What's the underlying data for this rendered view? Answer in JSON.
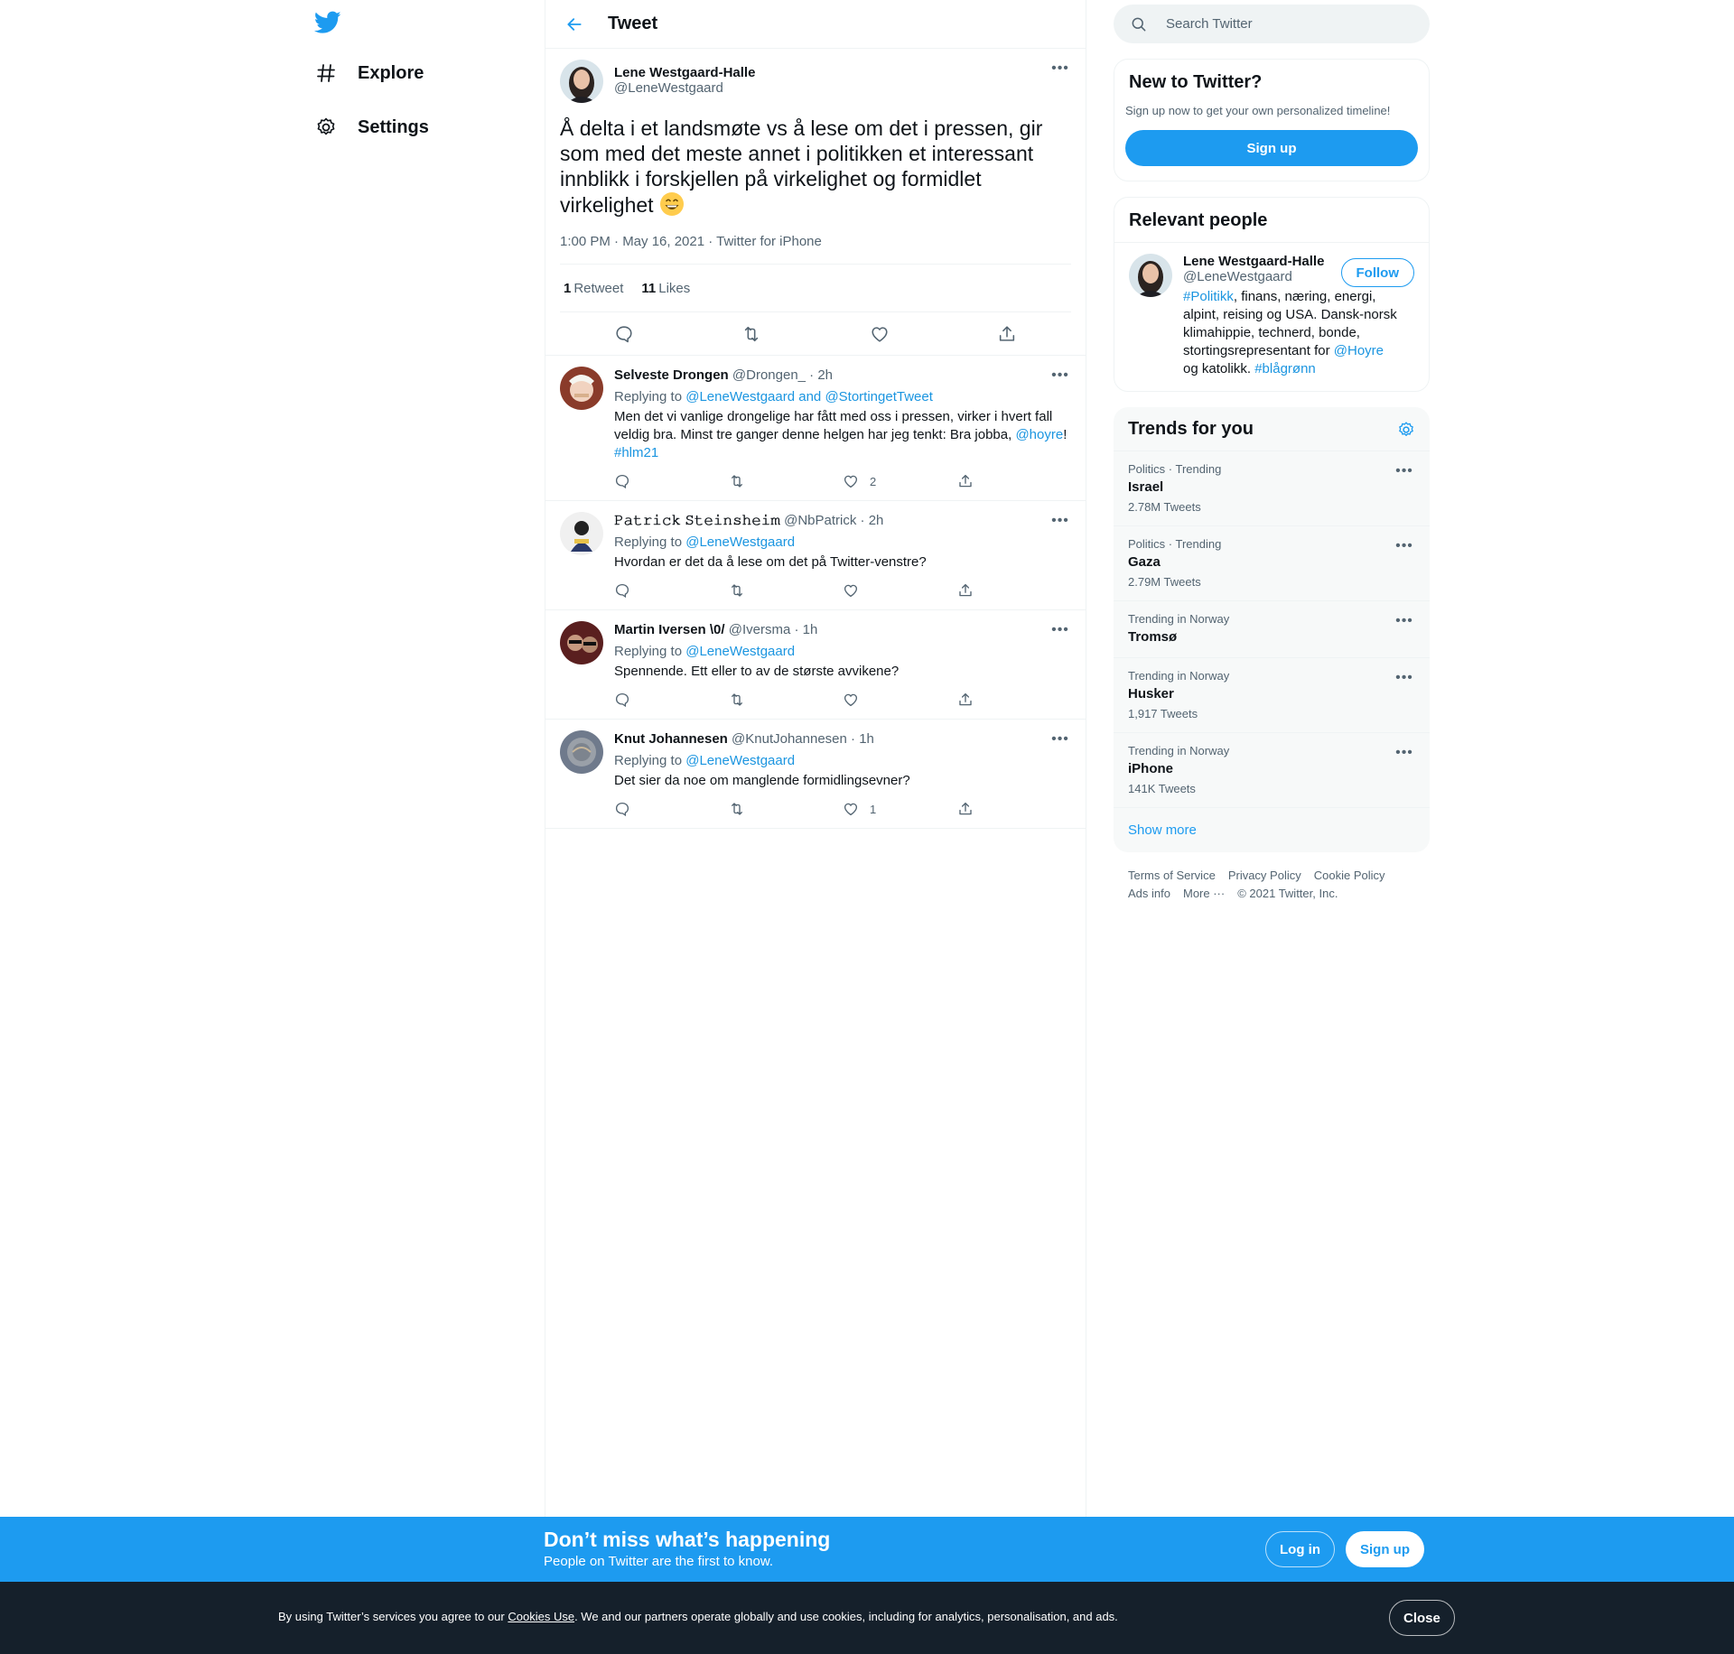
{
  "colors": {
    "accent": "#1d9bf0",
    "text": "#0f1419",
    "secondary": "#536471",
    "cookie_bg": "#15202b"
  },
  "nav": {
    "logo_icon": "twitter-bird-icon",
    "items": [
      {
        "label": "Explore",
        "icon": "hashtag-icon"
      },
      {
        "label": "Settings",
        "icon": "gear-icon"
      }
    ]
  },
  "header": {
    "title": "Tweet",
    "back_icon": "arrow-left-icon"
  },
  "tweet": {
    "author_name": "Lene Westgaard-Halle",
    "author_handle": "@LeneWestgaard",
    "text": "Å delta i et landsmøte vs å lese om det i pressen, gir som med det meste annet i politikken et interessant innblikk i forskjellen på virkelighet og formidlet virkelighet",
    "emoji": "grinning-face-emoji",
    "timestamp": "1:00 PM · May 16, 2021 · Twitter for iPhone",
    "retweets_count": "1",
    "retweets_label": "Retweet",
    "likes_count": "11",
    "likes_label": "Likes"
  },
  "replies": [
    {
      "name": "Selveste Drongen",
      "handle": "@Drongen_",
      "time": "· 2h",
      "replying_prefix": "Replying to",
      "replying_to": "@LeneWestgaard and @StortingetTweet",
      "text_before": "Men det vi vanlige drongelige har fått med oss i pressen, virker i hvert fall veldig bra. Minst tre ganger denne helgen har jeg tenkt: Bra jobba,",
      "mention": "@hoyre",
      "text_after": "!",
      "hashtag": "#hlm21",
      "likes": "2"
    },
    {
      "name": "𝙿𝚊𝚝𝚛𝚒𝚌𝚔 𝚂𝚝𝚎𝚒𝚗𝚜𝚑𝚎𝚒𝚖",
      "handle": "@NbPatrick",
      "time": "· 2h",
      "replying_prefix": "Replying to",
      "replying_to": "@LeneWestgaard",
      "text": "Hvordan er det da å lese om det på Twitter-venstre?",
      "likes": ""
    },
    {
      "name": "Martin Iversen \\0/",
      "handle": "@Iversma",
      "time": "· 1h",
      "replying_prefix": "Replying to",
      "replying_to": "@LeneWestgaard",
      "text": "Spennende. Ett eller to av de største avvikene?",
      "likes": ""
    },
    {
      "name": "Knut Johannesen",
      "handle": "@KnutJohannesen",
      "time": "· 1h",
      "replying_prefix": "Replying to",
      "replying_to": "@LeneWestgaard",
      "text": "Det sier da noe om manglende formidlingsevner?",
      "likes": "1"
    }
  ],
  "search": {
    "placeholder": "Search Twitter"
  },
  "new_to_twitter": {
    "title": "New to Twitter?",
    "subtitle": "Sign up now to get your own personalized timeline!",
    "button": "Sign up"
  },
  "relevant_people": {
    "title": "Relevant people",
    "name": "Lene Westgaard-Halle",
    "handle": "@LeneWestgaard",
    "follow": "Follow",
    "bio_tag1": "#Politikk",
    "bio_part1": ", finans, næring, energi, alpint, reising og USA. Dansk-norsk klimahippie, technerd, bonde, stortingsrepresentant for ",
    "bio_mention": "@Hoyre",
    "bio_part2": " og katolikk. ",
    "bio_tag2": "#blågrønn"
  },
  "trends": {
    "title": "Trends for you",
    "items": [
      {
        "context": "Politics · Trending",
        "name": "Israel",
        "count": "2.78M Tweets"
      },
      {
        "context": "Politics · Trending",
        "name": "Gaza",
        "count": "2.79M Tweets"
      },
      {
        "context": "Trending in Norway",
        "name": "Tromsø",
        "count": ""
      },
      {
        "context": "Trending in Norway",
        "name": "Husker",
        "count": "1,917 Tweets"
      },
      {
        "context": "Trending in Norway",
        "name": "iPhone",
        "count": "141K Tweets"
      }
    ],
    "show_more": "Show more"
  },
  "footer": {
    "terms": "Terms of Service",
    "privacy": "Privacy Policy",
    "cookie": "Cookie Policy",
    "ads": "Ads info",
    "more": "More ···",
    "copyright": "© 2021 Twitter, Inc."
  },
  "banner": {
    "title": "Don’t miss what’s happening",
    "subtitle": "People on Twitter are the first to know.",
    "login": "Log in",
    "signup": "Sign up"
  },
  "cookie_bar": {
    "prefix": "By using Twitter’s services you agree to our ",
    "link": "Cookies Use",
    "suffix": ". We and our partners operate globally and use cookies, including for analytics, personalisation, and ads.",
    "close": "Close"
  }
}
